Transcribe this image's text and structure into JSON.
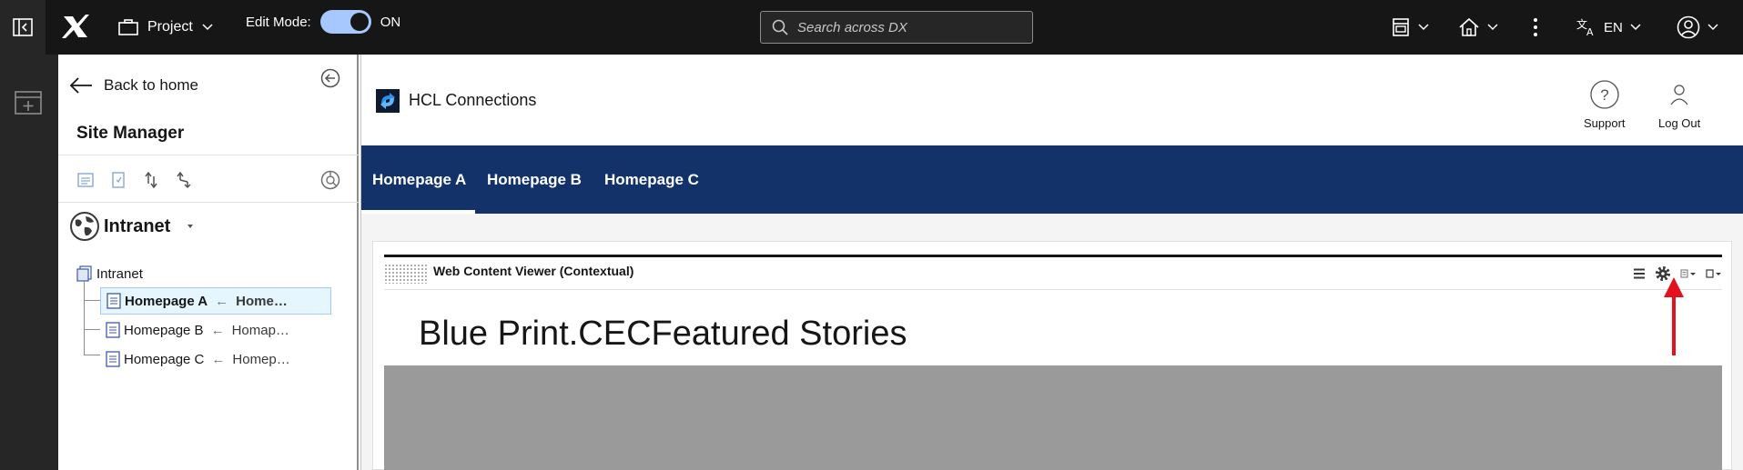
{
  "topbar": {
    "project_label": "Project",
    "edit_mode_label": "Edit Mode:",
    "edit_mode_state": "ON",
    "search_placeholder": "Search across DX",
    "language": "EN"
  },
  "panel": {
    "back_label": "Back to home",
    "title": "Site Manager",
    "site_name": "Intranet",
    "tree": {
      "root": "Intranet",
      "children": [
        {
          "label": "Homepage A",
          "suffix": "Home…",
          "selected": true
        },
        {
          "label": "Homepage B",
          "suffix": "Homap…",
          "selected": false
        },
        {
          "label": "Homepage C",
          "suffix": "Homep…",
          "selected": false
        }
      ]
    }
  },
  "preview": {
    "brand_title": "HCL Connections",
    "support_label": "Support",
    "logout_label": "Log Out",
    "nav_tabs": [
      "Homepage A",
      "Homepage B",
      "Homepage C"
    ],
    "active_tab": 0,
    "portlet_title": "Web Content Viewer (Contextual)",
    "portlet_heading": "Blue Print.CECFeatured Stories"
  },
  "colors": {
    "topbar_bg": "#161616",
    "nav_bg": "#13326a",
    "toggle_on": "#a6c8ff",
    "annotation_arrow": "#e3101e",
    "content_gray": "#999a99"
  }
}
